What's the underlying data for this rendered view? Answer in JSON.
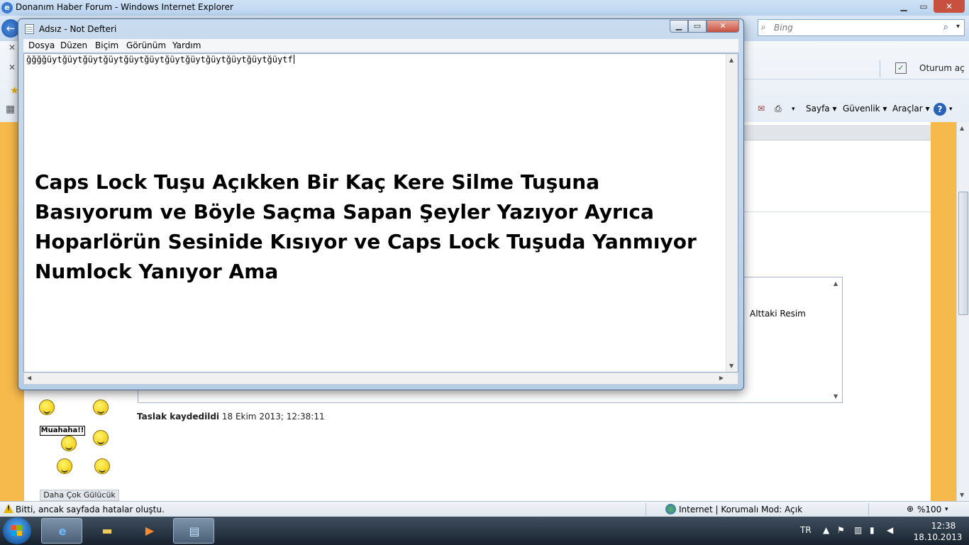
{
  "ie": {
    "title": "Donanım Haber Forum - Windows Internet Explorer",
    "search_placeholder": "Bing",
    "login_label": "Oturum aç",
    "commands": {
      "page": "Sayfa ▾",
      "security": "Güvenlik ▾",
      "tools": "Araçlar ▾"
    },
    "editor_text": "Alttaki Resim",
    "draft_label": "Taslak kaydedildi",
    "draft_time": "18 Ekim 2013; 12:38:11",
    "smiley_sign": "Muahaha!!",
    "more_smilies": "Daha Çok Gülücük",
    "status_message": "Bitti, ancak sayfada hatalar oluştu.",
    "status_zone": "Internet | Korumalı Mod: Açık",
    "zoom": "%100"
  },
  "notepad": {
    "title": "Adsız - Not Defteri",
    "menu": [
      "Dosya",
      "Düzen",
      "Biçim",
      "Görünüm",
      "Yardım"
    ],
    "content_line": "ğğğğüytğüytğüytğüytğüytğüytğüytğüytğüytğüytğüytğüytf",
    "message": "Caps Lock Tuşu Açıkken Bir Kaç Kere Silme Tuşuna Basıyorum ve Böyle Saçma Sapan Şeyler Yazıyor Ayrıca Hoparlörün Sesinide Kısıyor ve Caps Lock Tuşuda Yanmıyor Numlock Yanıyor Ama"
  },
  "taskbar": {
    "language": "TR",
    "time": "12:38",
    "date": "18.10.2013"
  },
  "colors": {
    "page_band": "#f6b94b",
    "taskbar": "#18222e",
    "title_bar": "#c9dbee"
  }
}
